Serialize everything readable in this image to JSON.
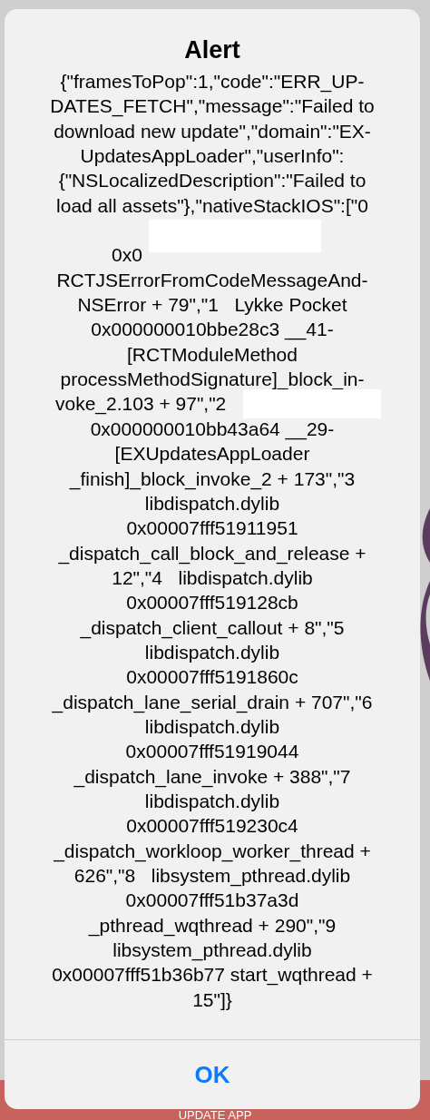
{
  "background": {
    "button": "UPDATE APP"
  },
  "alert": {
    "title": "Alert",
    "message_parts": [
      "{\"framesToPop\":1,\"code\":\"ERR_UP-\nDATES_FETCH\",\"message\":\"Failed to\ndownload new update\",\"domain\":\"EX-\nUpdatesAppLoader\",\"userInfo\":\n{\"NSLocalizedDescription\":\"Failed to\nload all assets\"},\"nativeStackIOS\":[\"0",
      "0x0",
      "RCTJSErrorFromCodeMessageAnd-\nNSError + 79\",\"1   Lykke Pocket\n0x000000010bbe28c3 __41-\n[RCTModuleMethod\nprocessMethodSignature]_block_in-",
      "voke_2.103 + 97\",\"2",
      "0x000000010bb43a64 __29-\n[EXUpdatesAppLoader\n_finish]_block_invoke_2 + 173\",\"3\nlibdispatch.dylib\n0x00007fff51911951\n_dispatch_call_block_and_release +\n12\",\"4   libdispatch.dylib\n0x00007fff519128cb\n_dispatch_client_callout + 8\",\"5\nlibdispatch.dylib\n0x00007fff5191860c\n_dispatch_lane_serial_drain + 707\",\"6\nlibdispatch.dylib\n0x00007fff51919044\n_dispatch_lane_invoke + 388\",\"7\nlibdispatch.dylib\n0x00007fff519230c4\n_dispatch_workloop_worker_thread +\n626\",\"8   libsystem_pthread.dylib\n0x00007fff51b37a3d\n_pthread_wqthread + 290\",\"9\nlibsystem_pthread.dylib\n0x00007fff51b36b77 start_wqthread +\n15\"]}"
    ],
    "buttons": [
      "OK"
    ]
  }
}
